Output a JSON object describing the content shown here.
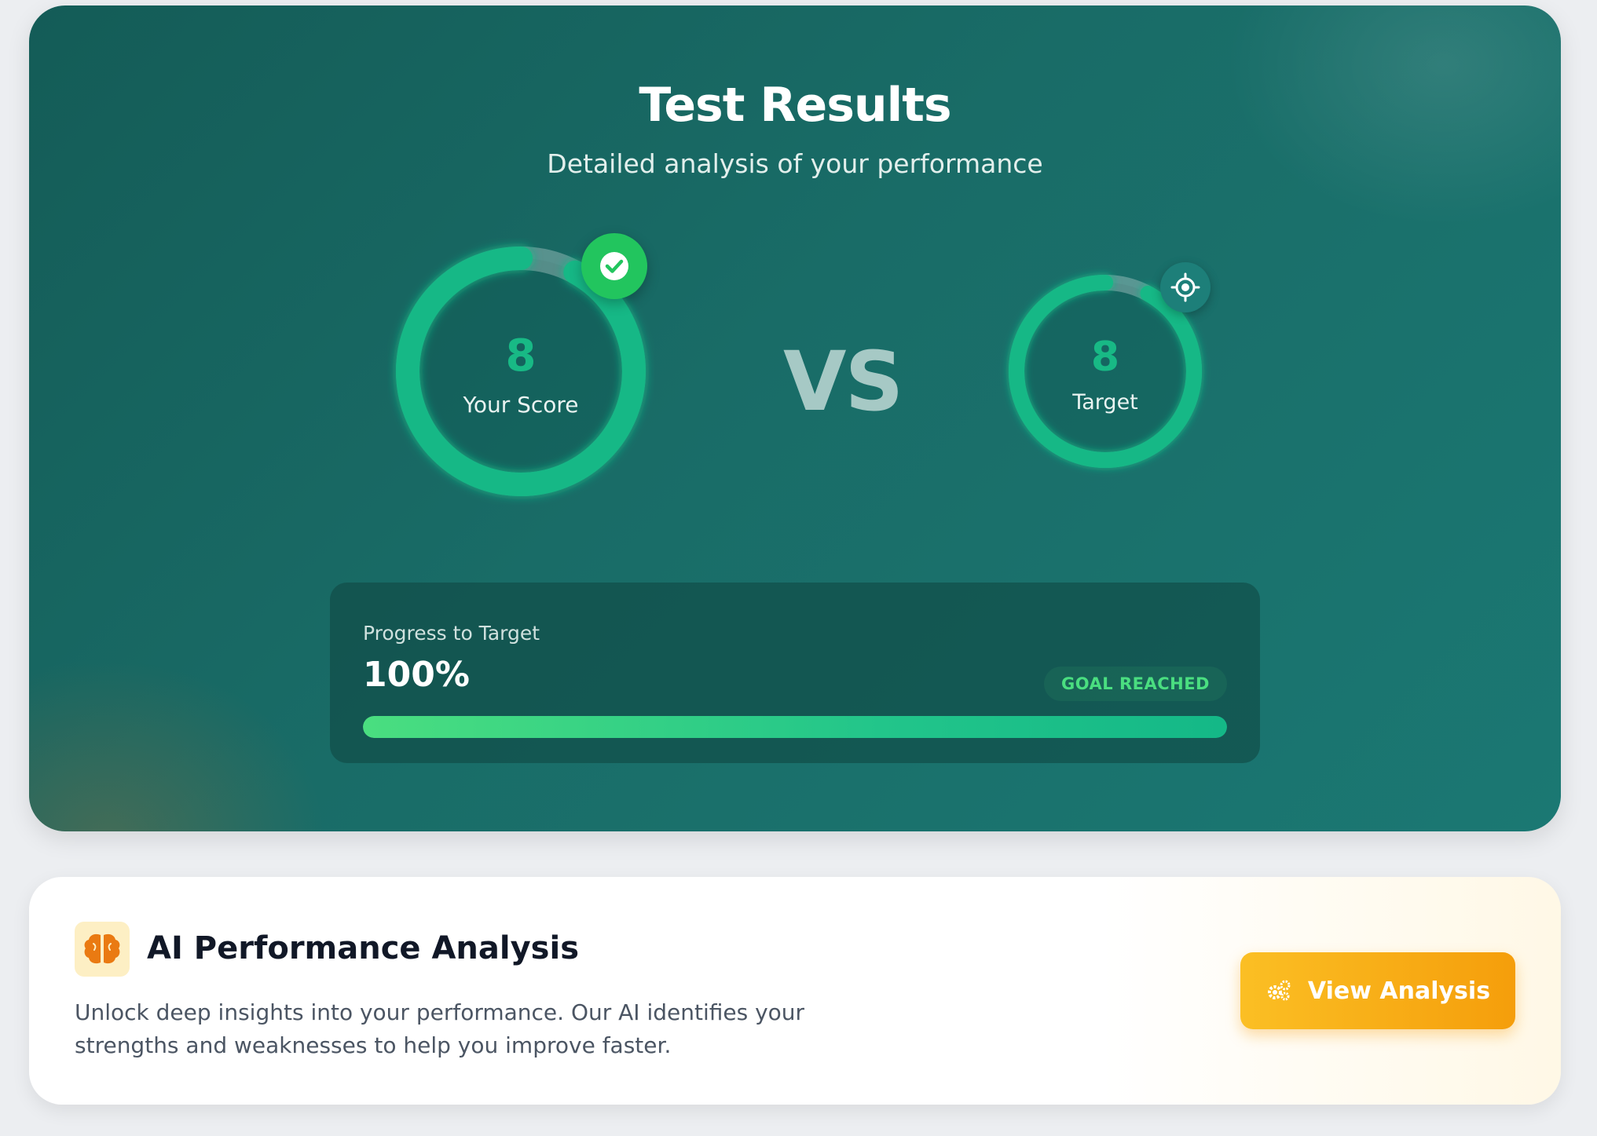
{
  "header": {
    "title": "Test Results",
    "subtitle": "Detailed analysis of your performance"
  },
  "score": {
    "value": "8",
    "label": "Your Score",
    "ring_fill_fraction": 0.92,
    "badge_icon": "check-circle-icon"
  },
  "vs_text": "VS",
  "target": {
    "value": "8",
    "label": "Target",
    "ring_fill_fraction": 0.92,
    "badge_icon": "crosshair-icon"
  },
  "progress": {
    "label": "Progress to Target",
    "value_text": "100%",
    "fraction": 1.0,
    "status_badge": "GOAL REACHED"
  },
  "analysis": {
    "title": "AI Performance Analysis",
    "description": "Unlock deep insights into your performance. Our AI identifies your strengths and weaknesses to help you improve faster.",
    "button_label": "View Analysis",
    "button_icon": "gears-icon",
    "title_icon": "brain-icon"
  },
  "colors": {
    "accent_green": "#18b985",
    "goal_green": "#4ade80",
    "card_teal": "#196c67",
    "button_amber": "#f59e0b"
  }
}
